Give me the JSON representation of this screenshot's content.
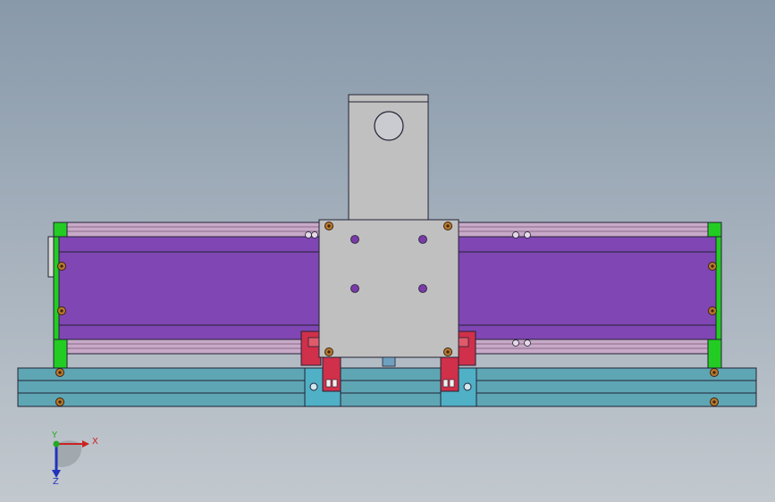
{
  "viewport": {
    "background_top": "#8899aa",
    "background_bottom": "#c2c8ce"
  },
  "model": {
    "colors": {
      "base_plate": "#5fa6b5",
      "rail_housing": "#8046b3",
      "end_cap": "#22cc22",
      "carriage_plate": "#c0c0c0",
      "motor_bracket": "#c0c0c0",
      "slider_block": "#d0304a",
      "bearing_block": "#4fb0c6",
      "guide_rail": "#c8a9c8",
      "screw_head": "#b8782d"
    }
  },
  "triad": {
    "x_label": "X",
    "y_label": "Y",
    "z_label": "Z",
    "x_color": "#cc2222",
    "y_color": "#22aa22",
    "z_color": "#2233bb"
  }
}
